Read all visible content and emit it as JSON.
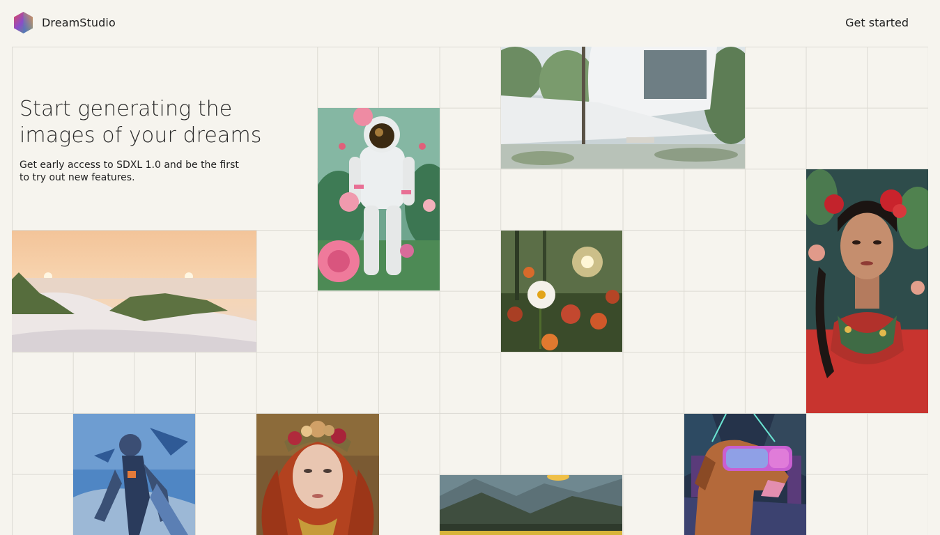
{
  "header": {
    "brand": "DreamStudio",
    "cta_label": "Get started"
  },
  "hero": {
    "title": "Start generating the images of your dreams",
    "subtitle": "Get early access to SDXL 1.0 and be the first to try out new features."
  },
  "gallery": {
    "images": [
      "astronaut-with-roses",
      "modern-white-house",
      "beach-dunes-sunset",
      "daisy-forest-sunlight",
      "woman-with-red-flowers",
      "armored-pilot",
      "red-haired-woman-floral-crown",
      "mountain-valley-sunrise",
      "dog-with-vr-headset"
    ]
  },
  "colors": {
    "background": "#f6f4ee",
    "grid_line": "#dcdad3",
    "text": "#1f1f1f"
  }
}
